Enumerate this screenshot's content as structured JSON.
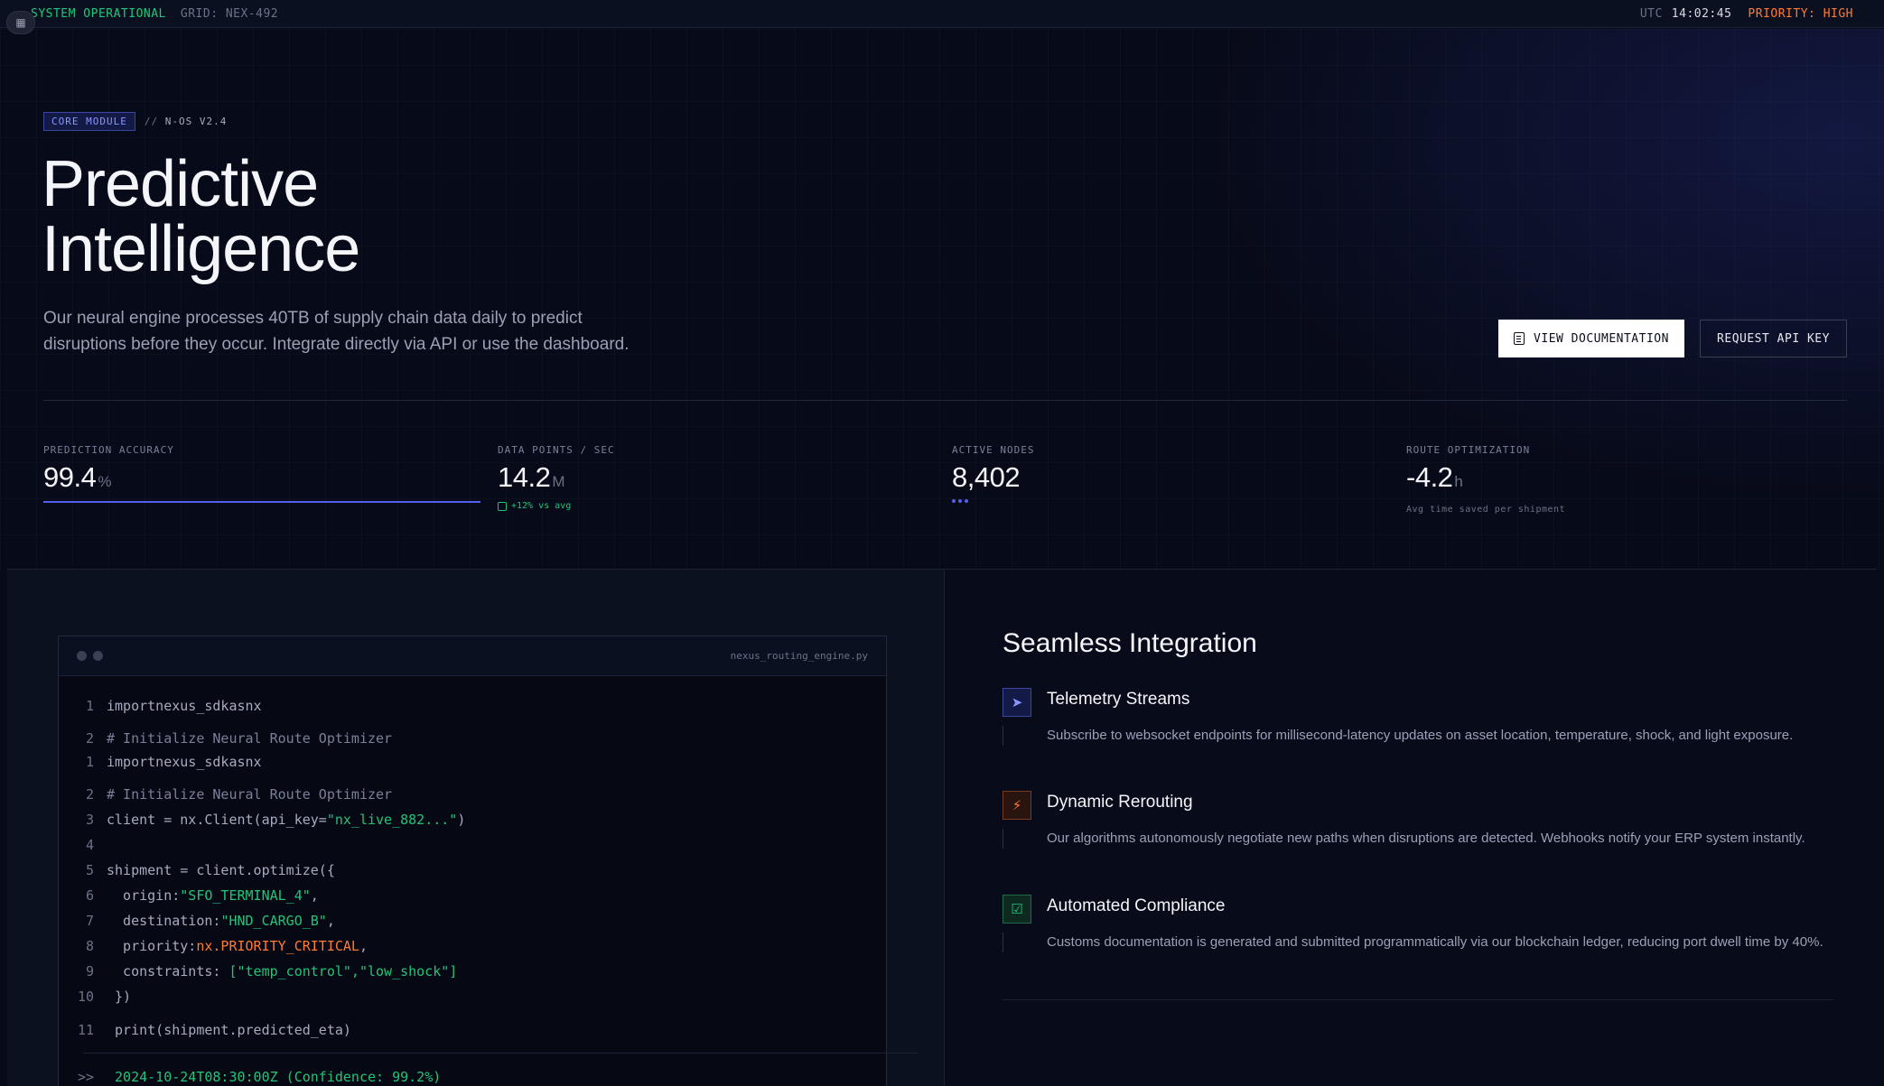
{
  "topbar": {
    "status": "SYSTEM OPERATIONAL",
    "grid": "GRID: NEX-492",
    "utc_label": "UTC",
    "time": "14:02:45",
    "priority": "PRIORITY: HIGH"
  },
  "hero": {
    "badge": "CORE MODULE",
    "badge_sep": "//",
    "version": "N-OS V2.4",
    "title_line1": "Predictive",
    "title_line2": "Intelligence",
    "lead_line1": "Our neural engine processes 40TB of supply chain data daily to predict",
    "lead_line2": "disruptions before they occur. Integrate directly via API or use the dashboard.",
    "btn_docs": "VIEW DOCUMENTATION",
    "btn_api": "REQUEST API KEY"
  },
  "stats": [
    {
      "label": "PREDICTION ACCURACY",
      "value": "99.4",
      "unit": "%"
    },
    {
      "label": "DATA POINTS / SEC",
      "value": "14.2",
      "unit": "M",
      "delta": "+12% vs avg"
    },
    {
      "label": "ACTIVE NODES",
      "value": "8,402",
      "unit": ""
    },
    {
      "label": "ROUTE OPTIMIZATION",
      "value": "-4.2",
      "unit": "h",
      "note": "Avg time saved per shipment"
    }
  ],
  "editor": {
    "filename": "nexus_routing_engine.py",
    "lines": [
      {
        "n": "1",
        "t": "importnexus_sdkasnx"
      },
      {
        "n": "2",
        "t": "# Initialize Neural Route Optimizer"
      },
      {
        "n": "1",
        "t": "importnexus_sdkasnx"
      },
      {
        "n": "2",
        "t": "# Initialize Neural Route Optimizer"
      },
      {
        "n": "3",
        "a": "client = nx.Client(api_key=",
        "s": "\"nx_live_882...\"",
        "b": ")"
      },
      {
        "n": "4",
        "t": ""
      },
      {
        "n": "5",
        "t": "shipment = client.optimize({"
      },
      {
        "n": "6",
        "a": "  origin:",
        "s": "\"SFO_TERMINAL_4\"",
        "b": ","
      },
      {
        "n": "7",
        "a": "  destination:",
        "s": "\"HND_CARGO_B\"",
        "b": ","
      },
      {
        "n": "8",
        "a": "  priority:",
        "k": "nx.PRIORITY_CRITICAL",
        "b": ","
      },
      {
        "n": "9",
        "a": "  constraints: ",
        "s": "[\"temp_control\",\"low_shock\"]",
        "b": ""
      },
      {
        "n": "10",
        "t": " })"
      },
      {
        "n": "11",
        "t": " print(shipment.predicted_eta)"
      }
    ],
    "prompt": ">>",
    "output": " 2024-10-24T08:30:00Z (Confidence: 99.2%)"
  },
  "integration": {
    "title": "Seamless Integration",
    "features": [
      {
        "title": "Telemetry Streams",
        "desc": "Subscribe to websocket endpoints for millisecond-latency updates on asset location, temperature, shock, and light exposure.",
        "icon": "satellite-icon"
      },
      {
        "title": "Dynamic Rerouting",
        "desc": "Our algorithms autonomously negotiate new paths when disruptions are detected. Webhooks notify your ERP system instantly.",
        "icon": "lightning-icon"
      },
      {
        "title": "Automated Compliance",
        "desc": "Customs documentation is generated and submitted programmatically via our blockchain ledger, reducing port dwell time by 40%.",
        "icon": "checklist-icon"
      }
    ]
  },
  "colors": {
    "accent": "#5560f0",
    "success": "#22c47a",
    "warning": "#ff7a33",
    "background": "#070a18"
  }
}
